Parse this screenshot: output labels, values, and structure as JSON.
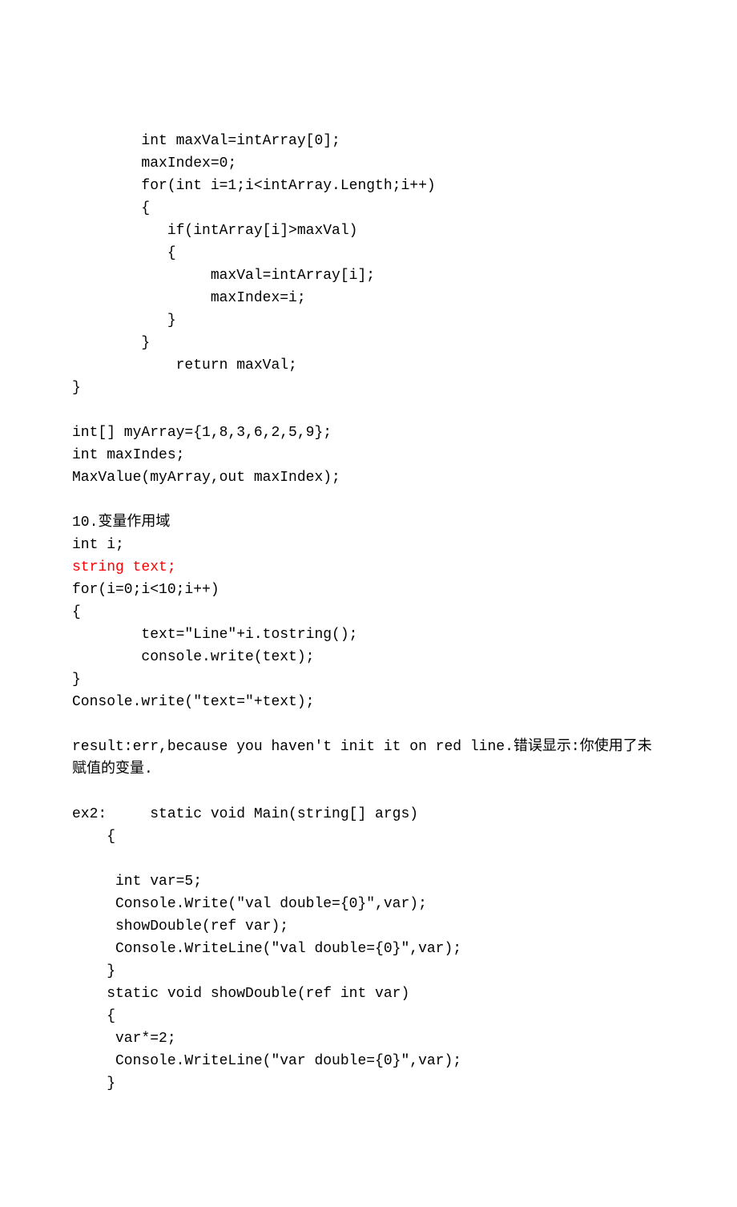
{
  "lines": [
    {
      "text": "        int maxVal=intArray[0];"
    },
    {
      "text": "        maxIndex=0;"
    },
    {
      "text": "        for(int i=1;i<intArray.Length;i++)"
    },
    {
      "text": "        {"
    },
    {
      "text": "           if(intArray[i]>maxVal)"
    },
    {
      "text": "           {"
    },
    {
      "text": "                maxVal=intArray[i];"
    },
    {
      "text": "                maxIndex=i;"
    },
    {
      "text": "           }"
    },
    {
      "text": "        }"
    },
    {
      "text": "            return maxVal;"
    },
    {
      "text": "}"
    },
    {
      "text": ""
    },
    {
      "text": "int[] myArray={1,8,3,6,2,5,9};"
    },
    {
      "text": "int maxIndes;"
    },
    {
      "text": "MaxValue(myArray,out maxIndex);"
    },
    {
      "text": ""
    },
    {
      "text": "10.变量作用域"
    },
    {
      "text": "int i;"
    },
    {
      "text": "string text;",
      "red": true
    },
    {
      "text": "for(i=0;i<10;i++)"
    },
    {
      "text": "{"
    },
    {
      "text": "        text=\"Line\"+i.tostring();"
    },
    {
      "text": "        console.write(text);"
    },
    {
      "text": "}"
    },
    {
      "text": "Console.write(\"text=\"+text);"
    },
    {
      "text": ""
    },
    {
      "text": "result:err,because you haven't init it on red line.错误显示:你使用了未"
    },
    {
      "text": "赋值的变量."
    },
    {
      "text": ""
    },
    {
      "text": "ex2:     static void Main(string[] args)"
    },
    {
      "text": "    {"
    },
    {
      "text": ""
    },
    {
      "text": "     int var=5;"
    },
    {
      "text": "     Console.Write(\"val double={0}\",var);"
    },
    {
      "text": "     showDouble(ref var);"
    },
    {
      "text": "     Console.WriteLine(\"val double={0}\",var);"
    },
    {
      "text": "    }"
    },
    {
      "text": "    static void showDouble(ref int var)"
    },
    {
      "text": "    {"
    },
    {
      "text": "     var*=2;"
    },
    {
      "text": "     Console.WriteLine(\"var double={0}\",var);"
    },
    {
      "text": "    }"
    }
  ]
}
